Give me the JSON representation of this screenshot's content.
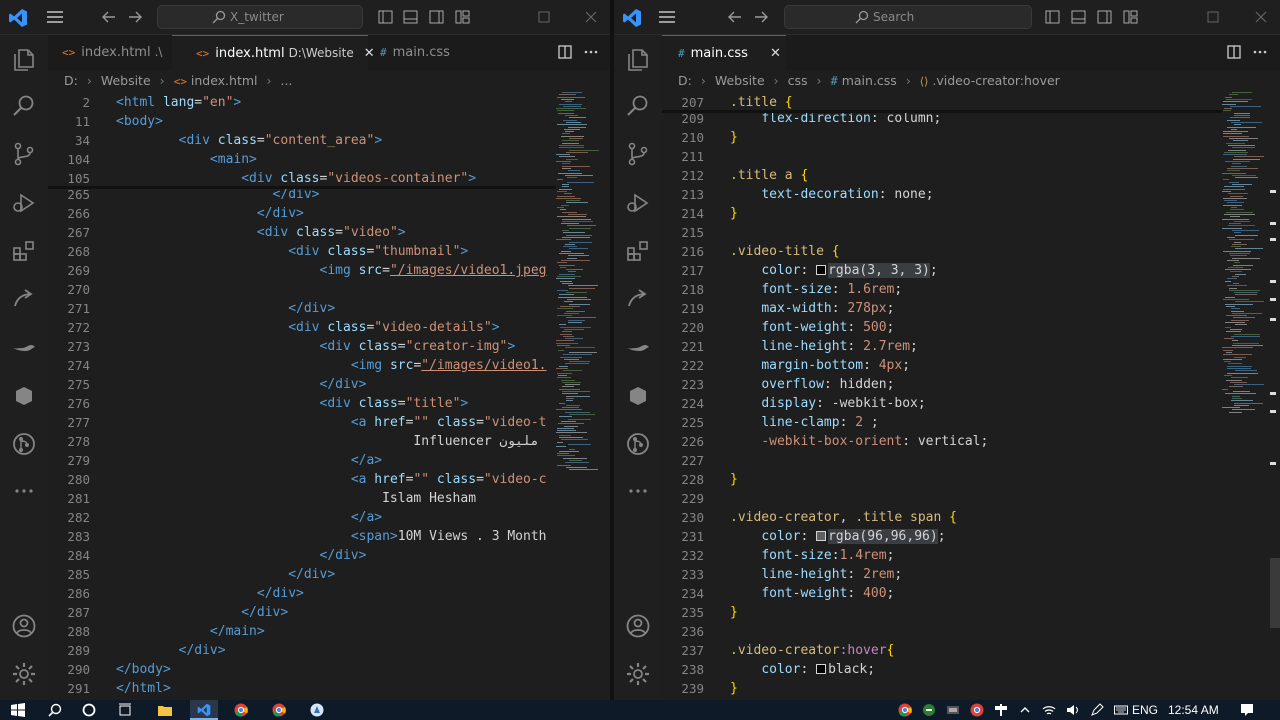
{
  "left": {
    "search_text": "X_twitter",
    "tabs": [
      {
        "icon": "<>",
        "label": "index.html",
        "sub": ".\\",
        "active": false
      },
      {
        "icon": "<>",
        "label": "index.html",
        "sub": "D:\\Website",
        "active": true
      },
      {
        "icon": "#",
        "label": "main.css",
        "sub": "",
        "active": false
      }
    ],
    "close_glyph": "✕",
    "breadcrumb": [
      "D:",
      "Website",
      "index.html",
      "..."
    ],
    "lines": [
      {
        "n": "2",
        "html": "<span class=\"tag\">&lt;html</span> <span class=\"attr\">lang</span><span class=\"pun\">=</span><span class=\"str\">\"en\"</span><span class=\"tag\">&gt;</span>"
      },
      {
        "n": "11",
        "html": "<span class=\"tag\">&lt;body&gt;</span>"
      },
      {
        "n": "34",
        "html": "        <span class=\"tag\">&lt;div</span> <span class=\"attr\">class</span><span class=\"pun\">=</span><span class=\"str\">\"content_area\"</span><span class=\"tag\">&gt;</span>"
      },
      {
        "n": "104",
        "html": "            <span class=\"tag\">&lt;main&gt;</span>"
      },
      {
        "n": "105",
        "html": "                <span class=\"tag\">&lt;div</span> <span class=\"attr\">class</span><span class=\"pun\">=</span><span class=\"str\">\"videos-container\"</span><span class=\"tag\">&gt;</span>"
      },
      {
        "n": "265",
        "html": "                    <span class=\"tag\">&lt;/div&gt;</span>"
      },
      {
        "n": "266",
        "html": "                  <span class=\"tag\">&lt;/div&gt;</span>"
      },
      {
        "n": "267",
        "html": "                  <span class=\"tag\">&lt;div</span> <span class=\"attr\">class</span><span class=\"pun\">=</span><span class=\"str\">\"video\"</span><span class=\"tag\">&gt;</span>"
      },
      {
        "n": "268",
        "html": "                      <span class=\"tag\">&lt;div</span> <span class=\"attr\">class</span><span class=\"pun\">=</span><span class=\"str\">\"thumbnail\"</span><span class=\"tag\">&gt;</span>"
      },
      {
        "n": "269",
        "html": "                          <span class=\"tag\">&lt;img</span> <span class=\"attr\">src</span><span class=\"pun\">=</span><span class=\"url\">\"/images/video1.jpeg</span>"
      },
      {
        "n": "270",
        "html": ""
      },
      {
        "n": "271",
        "html": "                      <span class=\"tag\">&lt;/div&gt;</span>"
      },
      {
        "n": "272",
        "html": "                      <span class=\"tag\">&lt;div</span> <span class=\"attr\">class</span><span class=\"pun\">=</span><span class=\"str\">\"video-details\"</span><span class=\"tag\">&gt;</span>"
      },
      {
        "n": "273",
        "html": "                          <span class=\"tag\">&lt;div</span> <span class=\"attr\">class</span><span class=\"pun\">=</span><span class=\"str\">\"creator-img\"</span><span class=\"tag\">&gt;</span>"
      },
      {
        "n": "274",
        "html": "                              <span class=\"tag\">&lt;img</span> <span class=\"attr\">src</span><span class=\"pun\">=</span><span class=\"url\">\"/images/video1.</span>"
      },
      {
        "n": "275",
        "html": "                          <span class=\"tag\">&lt;/div&gt;</span>"
      },
      {
        "n": "276",
        "html": "                          <span class=\"tag\">&lt;div</span> <span class=\"attr\">class</span><span class=\"pun\">=</span><span class=\"str\">\"title\"</span><span class=\"tag\">&gt;</span>"
      },
      {
        "n": "277",
        "html": "                              <span class=\"tag\">&lt;a</span> <span class=\"attr\">href</span><span class=\"pun\">=</span><span class=\"str\">\"\"</span> <span class=\"attr\">class</span><span class=\"pun\">=</span><span class=\"str\">\"video-t</span>"
      },
      {
        "n": "278",
        "html": "                                      <span class=\"txt\">Influencer مليون</span>"
      },
      {
        "n": "279",
        "html": "                              <span class=\"tag\">&lt;/a&gt;</span>"
      },
      {
        "n": "280",
        "html": "                              <span class=\"tag\">&lt;a</span> <span class=\"attr\">href</span><span class=\"pun\">=</span><span class=\"str\">\"\"</span> <span class=\"attr\">class</span><span class=\"pun\">=</span><span class=\"str\">\"video-c</span>"
      },
      {
        "n": "281",
        "html": "                                  <span class=\"txt\">Islam Hesham</span>"
      },
      {
        "n": "282",
        "html": "                              <span class=\"tag\">&lt;/a&gt;</span>"
      },
      {
        "n": "283",
        "html": "                              <span class=\"tag\">&lt;span&gt;</span><span class=\"txt\">10M Views . 3 Month</span>"
      },
      {
        "n": "284",
        "html": "                          <span class=\"tag\">&lt;/div&gt;</span>"
      },
      {
        "n": "285",
        "html": "                      <span class=\"tag\">&lt;/div&gt;</span>"
      },
      {
        "n": "286",
        "html": "                  <span class=\"tag\">&lt;/div&gt;</span>"
      },
      {
        "n": "287",
        "html": "                <span class=\"tag\">&lt;/div&gt;</span>"
      },
      {
        "n": "288",
        "html": "            <span class=\"tag\">&lt;/main&gt;</span>"
      },
      {
        "n": "289",
        "html": "        <span class=\"tag\">&lt;/div&gt;</span>"
      },
      {
        "n": "290",
        "html": "<span class=\"tag\">&lt;/body&gt;</span>"
      },
      {
        "n": "291",
        "html": "<span class=\"tag\">&lt;/html&gt;</span>"
      }
    ]
  },
  "right": {
    "search_text": "Search",
    "tabs": [
      {
        "icon": "#",
        "label": "main.css",
        "sub": "",
        "active": true
      }
    ],
    "close_glyph": "✕",
    "breadcrumb": [
      "D:",
      "Website",
      "css",
      "main.css",
      ".video-creator:hover"
    ],
    "lines": [
      {
        "n": "207",
        "html": "<span class=\"sel\">.title</span> <span class=\"br\">{</span>"
      },
      {
        "n": "209",
        "html": "    <span class=\"prop\">flex-direction</span><span class=\"pun\">: </span><span class=\"txt\">column</span><span class=\"pun\">;</span>"
      },
      {
        "n": "210",
        "html": "<span class=\"br\">}</span>"
      },
      {
        "n": "211",
        "html": ""
      },
      {
        "n": "212",
        "html": "<span class=\"sel\">.title a</span> <span class=\"br\">{</span>"
      },
      {
        "n": "213",
        "html": "    <span class=\"prop\">text-decoration</span><span class=\"pun\">: </span><span class=\"txt\">none</span><span class=\"pun\">;</span>"
      },
      {
        "n": "214",
        "html": "<span class=\"br\">}</span>"
      },
      {
        "n": "215",
        "html": ""
      },
      {
        "n": "216",
        "html": "<span class=\"sel\">.video-title</span> <span class=\"br\">{</span>"
      },
      {
        "n": "217",
        "html": "    <span class=\"prop\">color</span><span class=\"pun\">: </span><span class=\"swatch\" style=\"background:#030303\"></span><span class=\"txt hl\">rgba(3, 3, 3)</span><span class=\"pun\">;</span>"
      },
      {
        "n": "218",
        "html": "    <span class=\"prop\">font-size</span><span class=\"pun\">: </span><span class=\"val\">1.6rem</span><span class=\"pun\">;</span>"
      },
      {
        "n": "219",
        "html": "    <span class=\"prop\">max-width</span><span class=\"pun\">: </span><span class=\"val\">278px</span><span class=\"pun\">;</span>"
      },
      {
        "n": "220",
        "html": "    <span class=\"prop\">font-weight</span><span class=\"pun\">: </span><span class=\"val\">500</span><span class=\"pun\">;</span>"
      },
      {
        "n": "221",
        "html": "    <span class=\"prop\">line-height</span><span class=\"pun\">: </span><span class=\"val\">2.7rem</span><span class=\"pun\">;</span>"
      },
      {
        "n": "222",
        "html": "    <span class=\"prop\">margin-bottom</span><span class=\"pun\">: </span><span class=\"val\">4px</span><span class=\"pun\">;</span>"
      },
      {
        "n": "223",
        "html": "    <span class=\"prop\">overflow</span><span class=\"pun\">: </span><span class=\"txt\">hidden</span><span class=\"pun\">;</span>"
      },
      {
        "n": "224",
        "html": "    <span class=\"prop\">display</span><span class=\"pun\">: </span><span class=\"txt\">-webkit-box</span><span class=\"pun\">;</span>"
      },
      {
        "n": "225",
        "html": "    <span class=\"prop\">line-clamp</span><span class=\"pun\">: </span><span class=\"val\">2</span> <span class=\"pun\">;</span>"
      },
      {
        "n": "226",
        "html": "    <span class=\"val\">-webkit-box-orient</span><span class=\"pun\">: </span><span class=\"txt\">vertical</span><span class=\"pun\">;</span>"
      },
      {
        "n": "227",
        "html": ""
      },
      {
        "n": "228",
        "html": "<span class=\"br\">}</span>"
      },
      {
        "n": "229",
        "html": ""
      },
      {
        "n": "230",
        "html": "<span class=\"sel\">.video-creator</span><span class=\"pun\">, </span><span class=\"sel\">.title span</span> <span class=\"br\">{</span>"
      },
      {
        "n": "231",
        "html": "    <span class=\"prop\">color</span><span class=\"pun\">: </span><span class=\"swatch\" style=\"background:#606060\"></span><span class=\"txt hl\">rgba(96,96,96)</span><span class=\"pun\">;</span>"
      },
      {
        "n": "232",
        "html": "    <span class=\"prop\">font-size</span><span class=\"pun\">:</span><span class=\"val\">1.4rem</span><span class=\"pun\">;</span>"
      },
      {
        "n": "233",
        "html": "    <span class=\"prop\">line-height</span><span class=\"pun\">: </span><span class=\"val\">2rem</span><span class=\"pun\">;</span>"
      },
      {
        "n": "234",
        "html": "    <span class=\"prop\">font-weight</span><span class=\"pun\">: </span><span class=\"val\">400</span><span class=\"pun\">;</span>"
      },
      {
        "n": "235",
        "html": "<span class=\"br\">}</span>"
      },
      {
        "n": "236",
        "html": ""
      },
      {
        "n": "237",
        "html": "<span class=\"sel\">.video-creator</span><span class=\"ps\">:hover</span><span class=\"br\">{</span>"
      },
      {
        "n": "238",
        "html": "    <span class=\"prop\">color</span><span class=\"pun\">: </span><span class=\"swatch\" style=\"background:#000000\"></span><span class=\"txt\">black</span><span class=\"pun\">;</span>"
      },
      {
        "n": "239",
        "html": "<span class=\"br\">}</span>"
      }
    ]
  },
  "taskbar": {
    "language": "ENG",
    "time": "12:54 AM"
  },
  "colors": {
    "accent": "#0078d4",
    "vscode_blue": "#3794ff",
    "editor_bg": "#1e1e1e"
  }
}
